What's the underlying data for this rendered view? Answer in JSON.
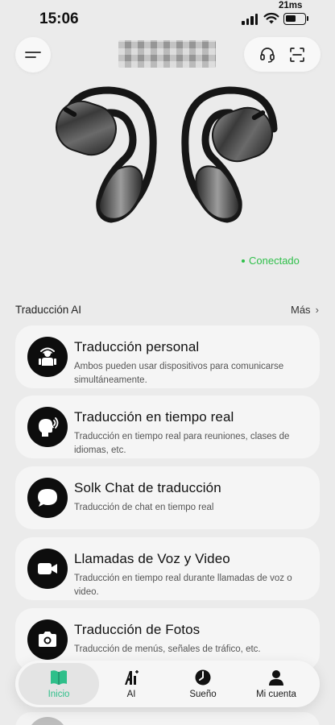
{
  "status_bar": {
    "time": "15:06",
    "latency": "21ms"
  },
  "header": {
    "menu_icon": "hamburger-menu-icon",
    "support_icon": "headset-icon",
    "scan_icon": "scan-icon",
    "device_name_redacted": true
  },
  "device": {
    "connection_status": "Conectado",
    "status_color": "#2fbf4a"
  },
  "section": {
    "title": "Traducción AI",
    "more_label": "Más"
  },
  "features": [
    {
      "icon": "translator-person-icon",
      "title": "Traducción personal",
      "description": "Ambos pueden usar dispositivos para comunicarse simultáneamente."
    },
    {
      "icon": "speaking-head-icon",
      "title": "Traducción en tiempo real",
      "description": "Traducción en tiempo real para reuniones, clases de idiomas, etc."
    },
    {
      "icon": "chat-bubble-icon",
      "title": "Solk Chat de traducción",
      "description": "Traducción de chat en tiempo real"
    },
    {
      "icon": "video-camera-icon",
      "title": "Llamadas de Voz y Video",
      "description": "Traducción en tiempo real durante llamadas de voz o video."
    },
    {
      "icon": "camera-icon",
      "title": "Traducción de Fotos",
      "description": "Traducción de menús, señales de tráfico, etc."
    }
  ],
  "bottom_nav": [
    {
      "icon": "book-icon",
      "label": "Inicio",
      "active": true
    },
    {
      "icon": "ai-icon",
      "label": "AI",
      "active": false
    },
    {
      "icon": "sleep-icon",
      "label": "Sueño",
      "active": false
    },
    {
      "icon": "person-icon",
      "label": "Mi cuenta",
      "active": false
    }
  ],
  "colors": {
    "accent_green": "#2fbf8a",
    "background": "#ebebeb",
    "card": "#f5f5f5"
  }
}
